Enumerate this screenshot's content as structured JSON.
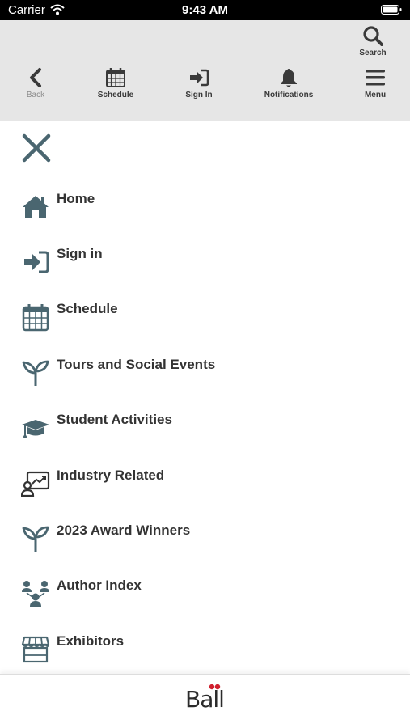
{
  "status_bar": {
    "carrier": "Carrier",
    "time": "9:43 AM"
  },
  "toolbar": {
    "search_label": "Search",
    "back_label": "Back",
    "schedule_label": "Schedule",
    "signin_label": "Sign In",
    "notifications_label": "Notifications",
    "menu_label": "Menu"
  },
  "menu": {
    "items": [
      {
        "label": "Home",
        "icon": "home-icon"
      },
      {
        "label": "Sign in",
        "icon": "sign-in-icon"
      },
      {
        "label": "Schedule",
        "icon": "calendar-icon"
      },
      {
        "label": "Tours and Social Events",
        "icon": "sprout-icon"
      },
      {
        "label": "Student Activities",
        "icon": "graduation-cap-icon"
      },
      {
        "label": "Industry Related",
        "icon": "presentation-icon"
      },
      {
        "label": "2023 Award Winners",
        "icon": "sprout-icon"
      },
      {
        "label": "Author Index",
        "icon": "users-icon"
      },
      {
        "label": "Exhibitors",
        "icon": "storefront-icon"
      }
    ]
  },
  "footer": {
    "logo_text": "Ball"
  },
  "colors": {
    "toolbar_bg": "#e6e6e6",
    "icon_teal": "#4a6670",
    "logo_dots": "#d0202e",
    "text_dark": "#333333"
  }
}
